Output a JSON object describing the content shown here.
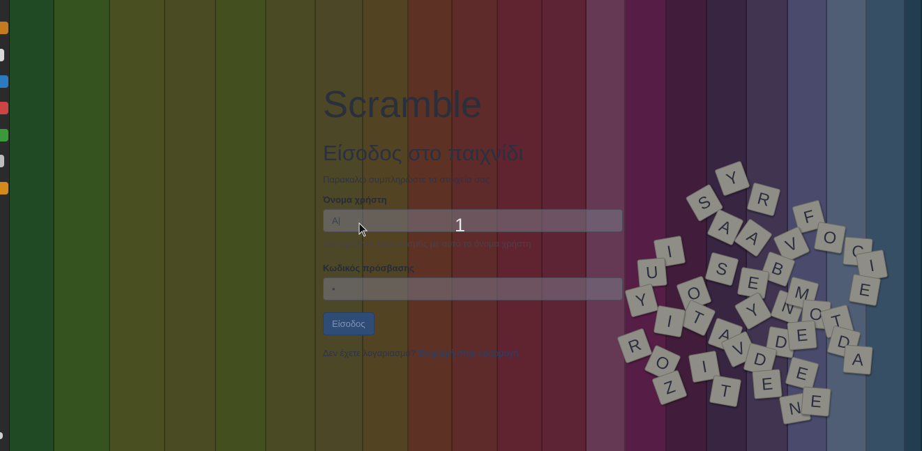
{
  "colors": {
    "stripes": [
      "#25552a",
      "#3d5f24",
      "#545a26",
      "#555628",
      "#4d5a24",
      "#55552b",
      "#57512c",
      "#5e4e28",
      "#6a3a29",
      "#6b3030",
      "#6e2938",
      "#6a2a3e",
      "#744060",
      "#622350",
      "#4b2244",
      "#3f2b4c",
      "#493c5d",
      "#55567c",
      "#5b6b86",
      "#3f5b74",
      "#26465b"
    ]
  },
  "app": {
    "title": "Scramble",
    "subtitle": "Είσοδος στο παιχνίδι",
    "hint": "Παρακαλώ συμπληρώστε τα στοιχεία σας"
  },
  "form": {
    "username_label": "Όνομα χρήστη",
    "username_value": "A|",
    "username_error": "Δεν βρέθηκε λογαριασμός με αυτό το όνομα χρήστη",
    "password_label": "Κωδικός πρόσβασης",
    "password_value": "•",
    "submit_label": "Είσοδος"
  },
  "footer": {
    "text": "Δεν έχετε λογαριασμό?",
    "link": "Εγγραφή στην εφαρμογή"
  },
  "overlay": {
    "step_number": "1"
  },
  "tiles": {
    "letters": [
      "Y",
      "R",
      "S",
      "A",
      "F",
      "O",
      "A",
      "V",
      "B",
      "C",
      "I",
      "U",
      "S",
      "O",
      "E",
      "T",
      "Y",
      "I",
      "Y",
      "N",
      "M",
      "O",
      "I",
      "E",
      "T",
      "A",
      "V",
      "D",
      "E",
      "D",
      "A",
      "R",
      "O",
      "I",
      "D",
      "Z",
      "T",
      "E",
      "E",
      "N",
      "E"
    ]
  },
  "dock": {
    "icons": [
      "firefox-icon",
      "window-icon",
      "blue-app-icon",
      "paint-icon",
      "green-app-icon",
      "document-icon",
      "star-icon",
      "grid-icon"
    ]
  }
}
